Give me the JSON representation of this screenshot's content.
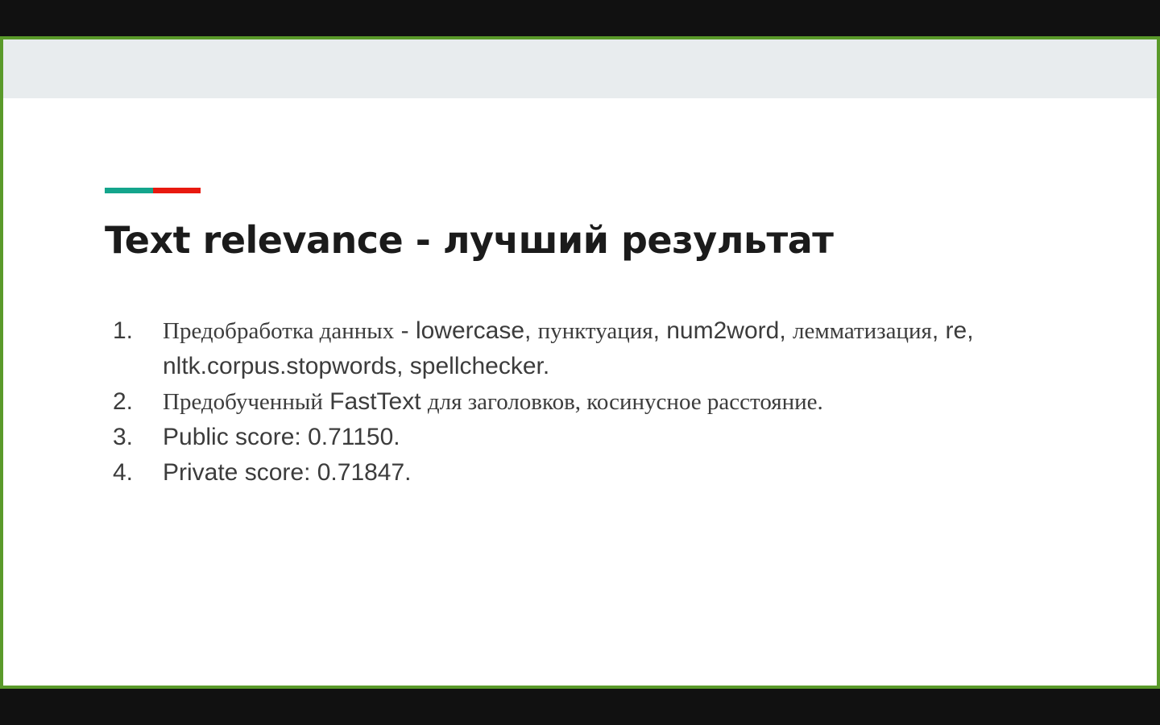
{
  "slide": {
    "title": "Text relevance - лучший результат",
    "accent_colors": [
      "#14a58c",
      "#e8190f"
    ],
    "frame_border_color": "#5a9a2a",
    "header_band_color": "#e8ecee",
    "items": [
      {
        "number": "1.",
        "parts": [
          "Предобработка данных",
          " - lowercase, ",
          "пунктуация",
          ", num2word, ",
          "лемматизация",
          ", re, nltk.corpus.stopwords, spellchecker."
        ]
      },
      {
        "number": "2.",
        "parts": [
          "Предобученный",
          " FastText ",
          "для заголовков, косинусное расстояние."
        ]
      },
      {
        "number": "3.",
        "text": "Public score: 0.71150."
      },
      {
        "number": "4.",
        "text": "Private score: 0.71847."
      }
    ]
  }
}
